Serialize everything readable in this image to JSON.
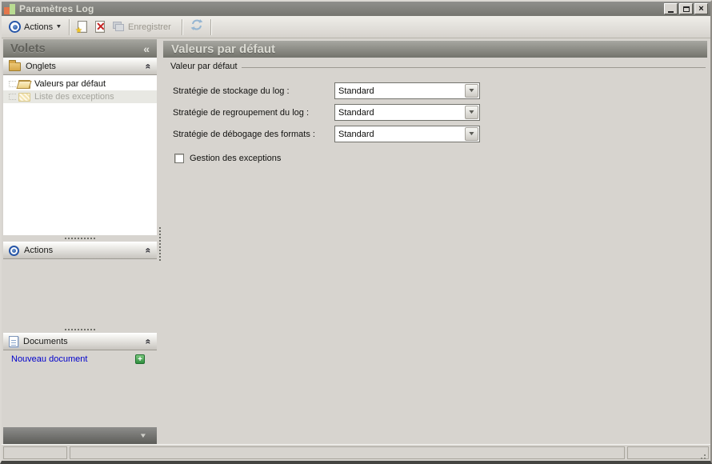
{
  "window": {
    "title": "Paramètres Log"
  },
  "toolbar": {
    "actions_label": "Actions",
    "save_label": "Enregistrer"
  },
  "sidebar": {
    "title": "Volets",
    "sections": {
      "onglets_label": "Onglets",
      "actions_label": "Actions",
      "documents_label": "Documents"
    },
    "tree_items": [
      {
        "label": "Valeurs par défaut",
        "state": "active"
      },
      {
        "label": "Liste des exceptions",
        "state": "disabled"
      }
    ],
    "new_document_label": "Nouveau document"
  },
  "main": {
    "title": "Valeurs par défaut",
    "group_label": "Valeur par défaut",
    "fields": [
      {
        "label": "Stratégie de stockage du log :",
        "value": "Standard"
      },
      {
        "label": "Stratégie de regroupement du log :",
        "value": "Standard"
      },
      {
        "label": "Stratégie de débogage des formats :",
        "value": "Standard"
      }
    ],
    "checkbox": {
      "label": "Gestion des exceptions",
      "checked": false
    }
  },
  "icons": {
    "panel_collapse": "«",
    "section_collapse": "«",
    "dropdown_arrow": "▼",
    "combo_arrow": "▼",
    "panel_menu_arrow": "▼",
    "close": "×"
  },
  "colors": {
    "titlebar": "#82827c",
    "header_gradient_top": "#a7a7a1",
    "header_gradient_bottom": "#73736c",
    "link": "#0000cc",
    "accent_blue": "#2756a8",
    "plus_green": "#2e8e3e",
    "window_bg": "#d7d4cf"
  }
}
